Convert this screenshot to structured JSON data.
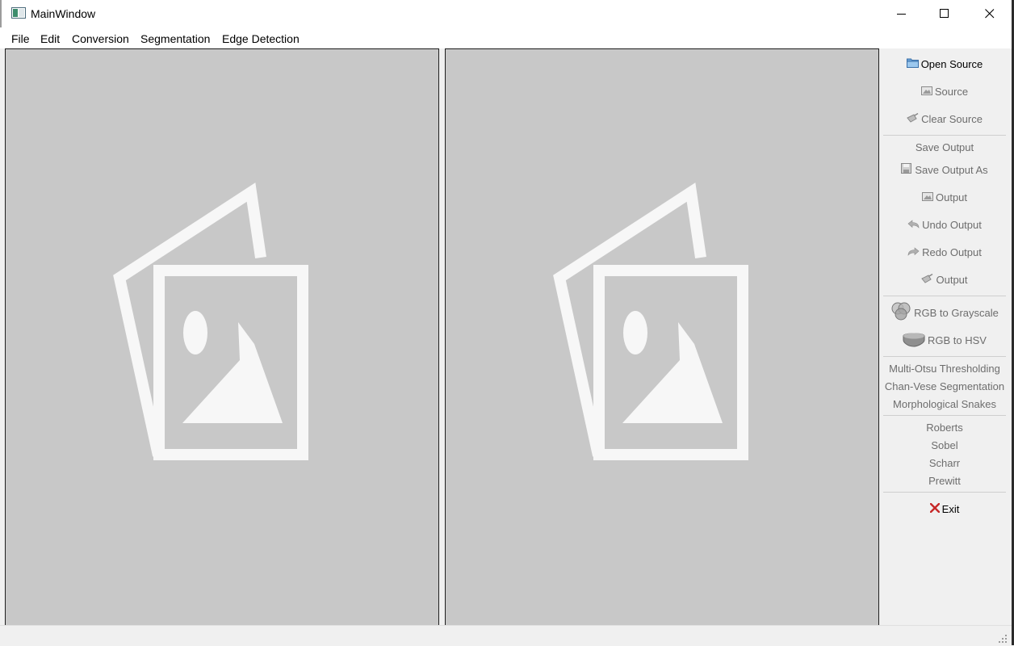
{
  "window": {
    "title": "MainWindow"
  },
  "menubar": {
    "items": [
      {
        "id": "file",
        "label": "File"
      },
      {
        "id": "edit",
        "label": "Edit"
      },
      {
        "id": "conversion",
        "label": "Conversion"
      },
      {
        "id": "segmentation",
        "label": "Segmentation"
      },
      {
        "id": "edge",
        "label": "Edge Detection"
      }
    ]
  },
  "panes": {
    "source": {
      "placeholder_icon": "image-placeholder-icon"
    },
    "output": {
      "placeholder_icon": "image-placeholder-icon"
    }
  },
  "sidebar": {
    "open_source": "Open Source",
    "source": "Source",
    "clear_source": "Clear Source",
    "save_output": "Save Output",
    "save_output_as": "Save Output As",
    "output": "Output",
    "undo_output": "Undo Output",
    "redo_output": "Redo Output",
    "clear_output": "Output",
    "rgb_to_gray": "RGB to Grayscale",
    "rgb_to_hsv": "RGB to HSV",
    "multi_otsu": "Multi-Otsu Thresholding",
    "chan_vese": "Chan-Vese Segmentation",
    "morph_snakes": "Morphological Snakes",
    "roberts": "Roberts",
    "sobel": "Sobel",
    "scharr": "Scharr",
    "prewitt": "Prewitt",
    "exit": "Exit"
  },
  "colors": {
    "pane_bg": "#c8c8c8",
    "disabled_text": "#6d6d6d",
    "exit_icon": "#c62828"
  }
}
